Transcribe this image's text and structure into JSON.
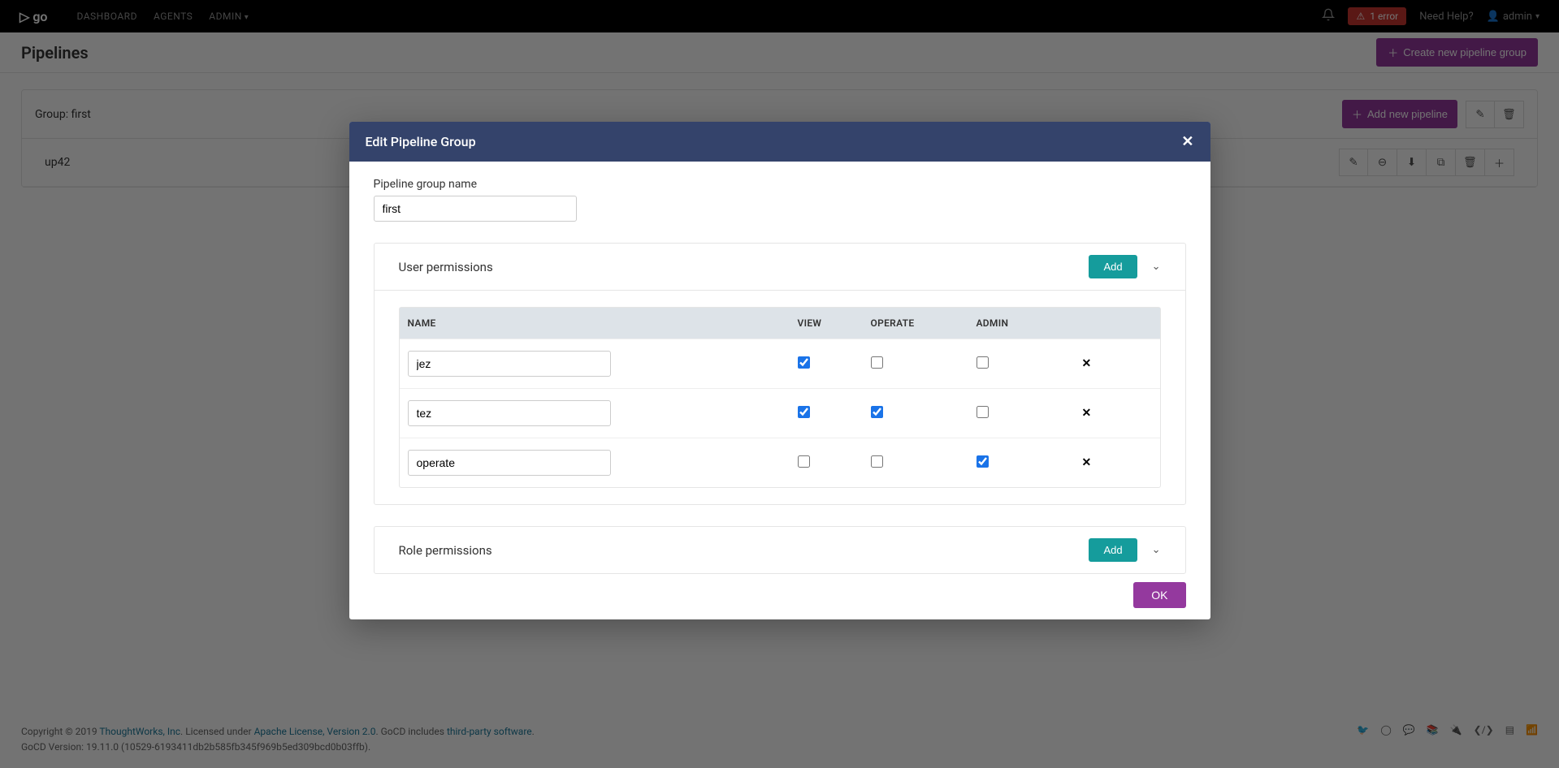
{
  "nav": {
    "logo": "go",
    "links": [
      "DASHBOARD",
      "AGENTS",
      "ADMIN"
    ],
    "error_badge": "1 error",
    "help": "Need Help?",
    "user": "admin"
  },
  "page": {
    "title": "Pipelines",
    "create_group_btn": "Create new pipeline group"
  },
  "group": {
    "label_prefix": "Group: ",
    "name": "first",
    "add_pipeline_btn": "Add new pipeline",
    "pipelines": [
      {
        "name": "up42"
      }
    ]
  },
  "modal": {
    "title": "Edit Pipeline Group",
    "group_name_label": "Pipeline group name",
    "group_name_value": "first",
    "user_perms": {
      "title": "User permissions",
      "add_btn": "Add",
      "columns": [
        "NAME",
        "VIEW",
        "OPERATE",
        "ADMIN"
      ],
      "rows": [
        {
          "name": "jez",
          "view": true,
          "operate": false,
          "admin": false
        },
        {
          "name": "tez",
          "view": true,
          "operate": true,
          "admin": false
        },
        {
          "name": "operate",
          "view": false,
          "operate": false,
          "admin": true
        }
      ]
    },
    "role_perms": {
      "title": "Role permissions",
      "add_btn": "Add"
    },
    "ok_btn": "OK"
  },
  "footer": {
    "copyright_prefix": "Copyright © 2019 ",
    "tw_link": "ThoughtWorks, Inc",
    "licensed": ". Licensed under ",
    "apache_link": "Apache License, Version 2.0",
    "includes": ". GoCD includes ",
    "third_party_link": "third-party software",
    "period": ".",
    "version": "GoCD Version: 19.11.0 (10529-6193411db2b585fb345f969b5ed309bcd0b03ffb)."
  }
}
